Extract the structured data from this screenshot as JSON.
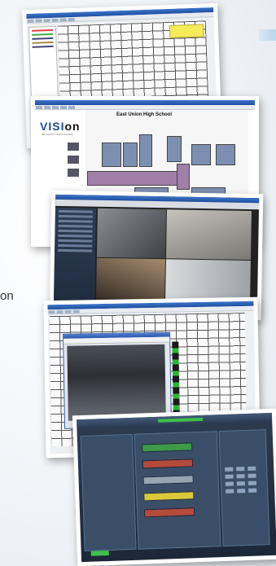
{
  "edge_text": "on",
  "cards": [
    {
      "name": "floorplan-editor-screenshot"
    },
    {
      "name": "vision-browser-screenshot",
      "logo_prefix": "VISI",
      "logo_suffix": "on",
      "logo_tagline": "SECURITY SOLUTIONS",
      "school_title": "East Union High School"
    },
    {
      "name": "camera-grid-screenshot"
    },
    {
      "name": "floorplan-camera-dialog-screenshot"
    },
    {
      "name": "security-console-screenshot"
    }
  ]
}
